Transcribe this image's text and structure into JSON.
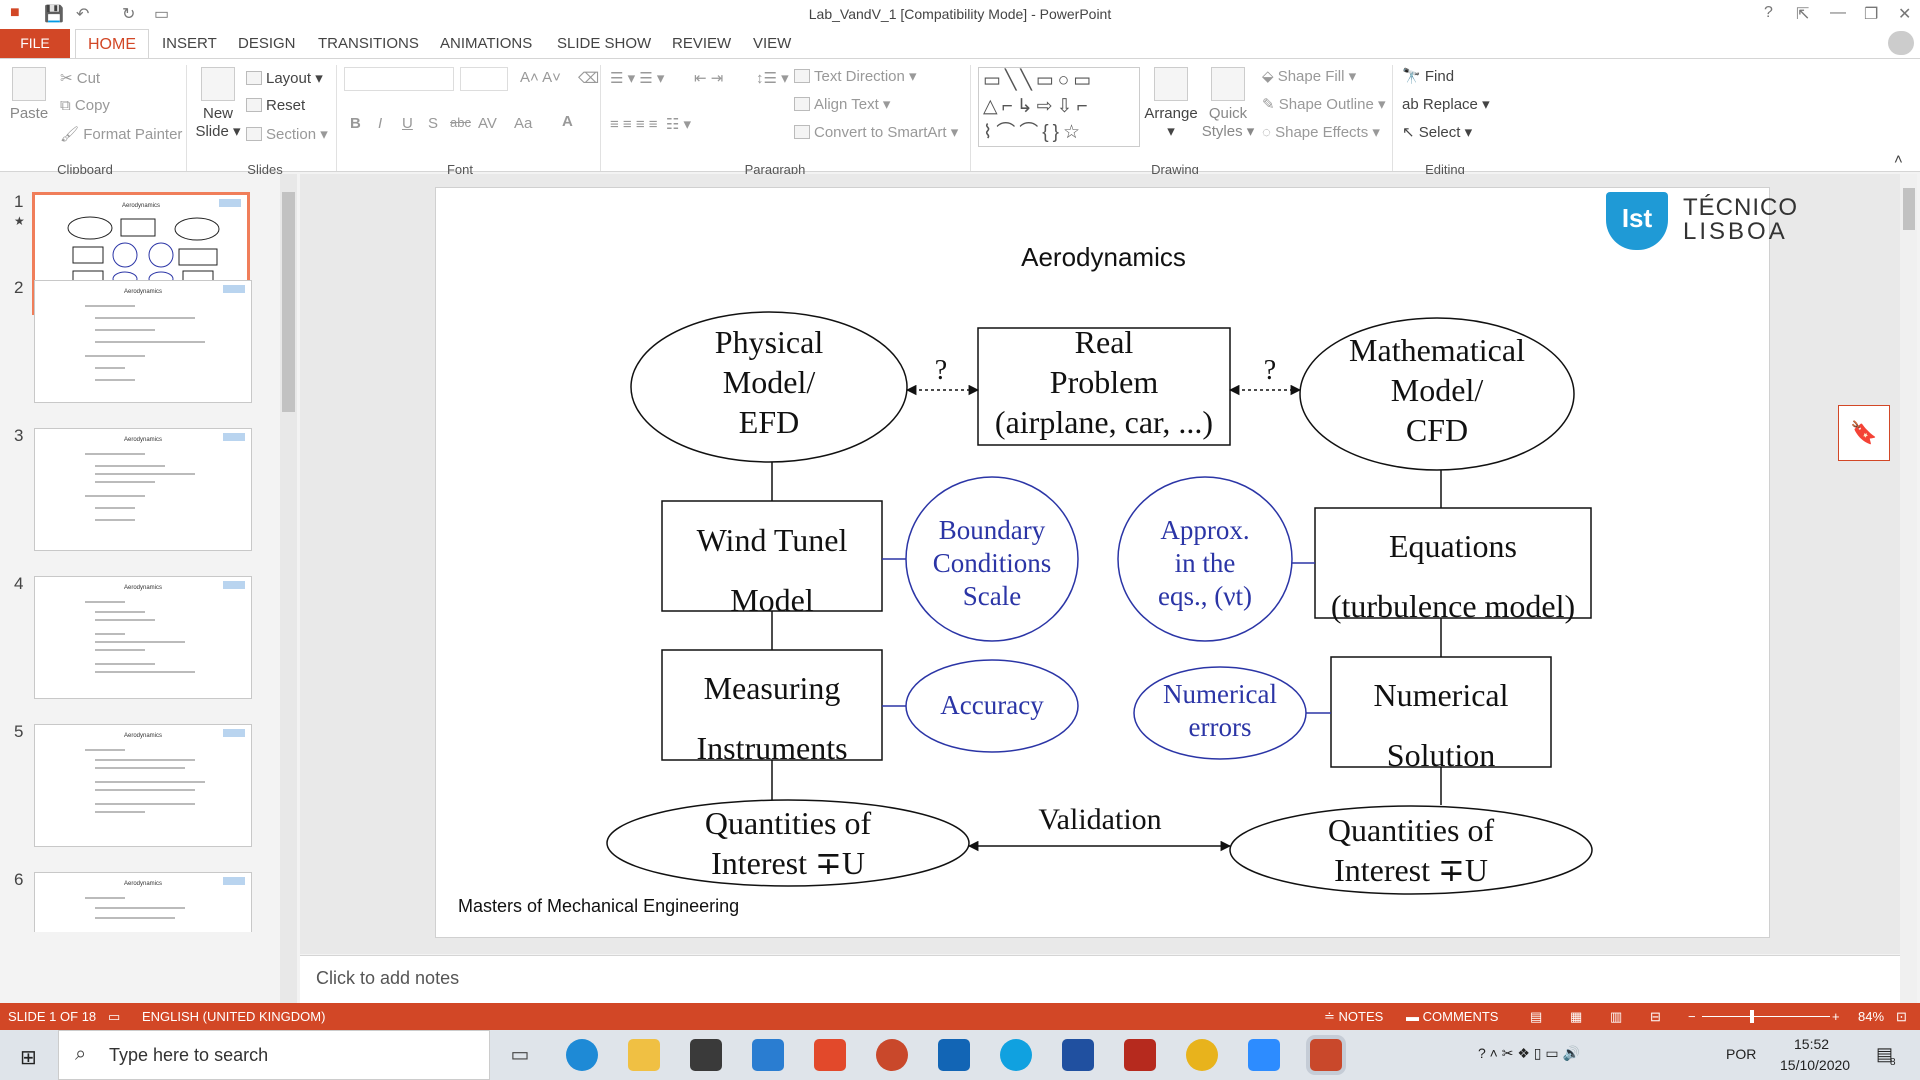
{
  "window": {
    "title": "Lab_VandV_1 [Compatibility Mode] - PowerPoint"
  },
  "tabs": [
    "FILE",
    "HOME",
    "INSERT",
    "DESIGN",
    "TRANSITIONS",
    "ANIMATIONS",
    "SLIDE SHOW",
    "REVIEW",
    "VIEW"
  ],
  "ribbon": {
    "clipboard": {
      "paste": "Paste",
      "cut": "Cut",
      "copy": "Copy",
      "format_painter": "Format Painter",
      "label": "Clipboard"
    },
    "slides": {
      "new_slide_1": "New",
      "new_slide_2": "Slide",
      "layout": "Layout",
      "reset": "Reset",
      "section": "Section",
      "label": "Slides"
    },
    "font": {
      "label": "Font",
      "bold": "B",
      "italic": "I",
      "underline": "U",
      "shadow": "S",
      "strike": "abc",
      "spacing": "AV",
      "case": "Aa",
      "color": "A"
    },
    "paragraph": {
      "text_direction": "Text Direction",
      "align_text": "Align Text",
      "smartart": "Convert to SmartArt",
      "label": "Paragraph"
    },
    "drawing": {
      "arrange": "Arrange",
      "quick_styles_1": "Quick",
      "quick_styles_2": "Styles",
      "shape_fill": "Shape Fill",
      "shape_outline": "Shape Outline",
      "shape_effects": "Shape Effects",
      "label": "Drawing"
    },
    "editing": {
      "find": "Find",
      "replace": "Replace",
      "select": "Select",
      "label": "Editing"
    }
  },
  "thumbnails": [
    {
      "num": "1",
      "title": "Aerodynamics"
    },
    {
      "num": "2",
      "title": "Aerodynamics"
    },
    {
      "num": "3",
      "title": "Aerodynamics"
    },
    {
      "num": "4",
      "title": "Aerodynamics"
    },
    {
      "num": "5",
      "title": "Aerodynamics"
    },
    {
      "num": "6",
      "title": "Aerodynamics"
    }
  ],
  "slide": {
    "title": "Aerodynamics",
    "logo_1": "TÉCNICO",
    "logo_2": "LISBOA",
    "footer": "Masters of Mechanical Engineering",
    "physical": [
      "Physical",
      "Model/",
      "EFD"
    ],
    "real": [
      "Real",
      "Problem",
      "(airplane, car, ...)"
    ],
    "math": [
      "Mathematical",
      "Model/",
      "CFD"
    ],
    "q_left": "?",
    "q_right": "?",
    "wind": [
      "Wind Tunel",
      "Model"
    ],
    "boundary": [
      "Boundary",
      "Conditions",
      "Scale"
    ],
    "approx": [
      "Approx.",
      "in the",
      "eqs., (νt)"
    ],
    "equations": [
      "Equations",
      "(turbulence model)"
    ],
    "measuring": [
      "Measuring",
      "Instruments"
    ],
    "accuracy": "Accuracy",
    "numerrors": [
      "Numerical",
      "errors"
    ],
    "numsol": [
      "Numerical",
      "Solution"
    ],
    "qoi_left": [
      "Quantities of",
      "Interest ∓U"
    ],
    "validation": "Validation",
    "qoi_right": [
      "Quantities of",
      "Interest ∓U"
    ]
  },
  "notes": {
    "placeholder": "Click to add notes"
  },
  "status": {
    "slide": "SLIDE 1 OF 18",
    "language": "ENGLISH (UNITED KINGDOM)",
    "notes": "NOTES",
    "comments": "COMMENTS",
    "zoom": "84%"
  },
  "taskbar": {
    "search": "Type here to search",
    "lang": "POR",
    "time": "15:52",
    "date": "15/10/2020",
    "notif": "8"
  },
  "colors": {
    "accent": "#d24726",
    "diagram_blue": "#2b35a6"
  }
}
